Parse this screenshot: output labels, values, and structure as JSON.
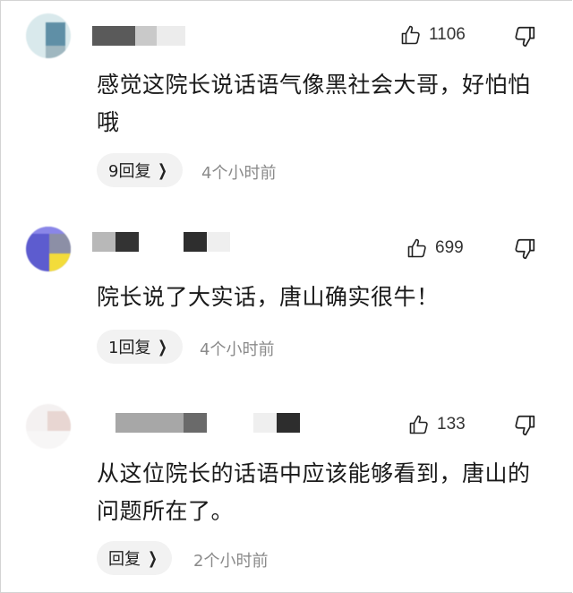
{
  "comments": [
    {
      "likes": "1106",
      "text": "感觉这院长说话语气像黑社会大哥，好怕怕哦",
      "reply_label": "9回复",
      "time": "4个小时前"
    },
    {
      "likes": "699",
      "text": "院长说了大实话，唐山确实很牛！",
      "reply_label": "1回复",
      "time": "4个小时前"
    },
    {
      "likes": "133",
      "text": "从这位院长的话语中应该能够看到，唐山的问题所在了。",
      "reply_label": "回复",
      "time": "2个小时前"
    }
  ],
  "icons": {
    "like": "thumbs-up-icon",
    "dislike": "thumbs-down-icon",
    "reply_arrow": "chevron-right-icon"
  },
  "colors": {
    "text": "#1a1a1a",
    "muted": "#8a8a8a",
    "pill": "#f2f2f2"
  }
}
